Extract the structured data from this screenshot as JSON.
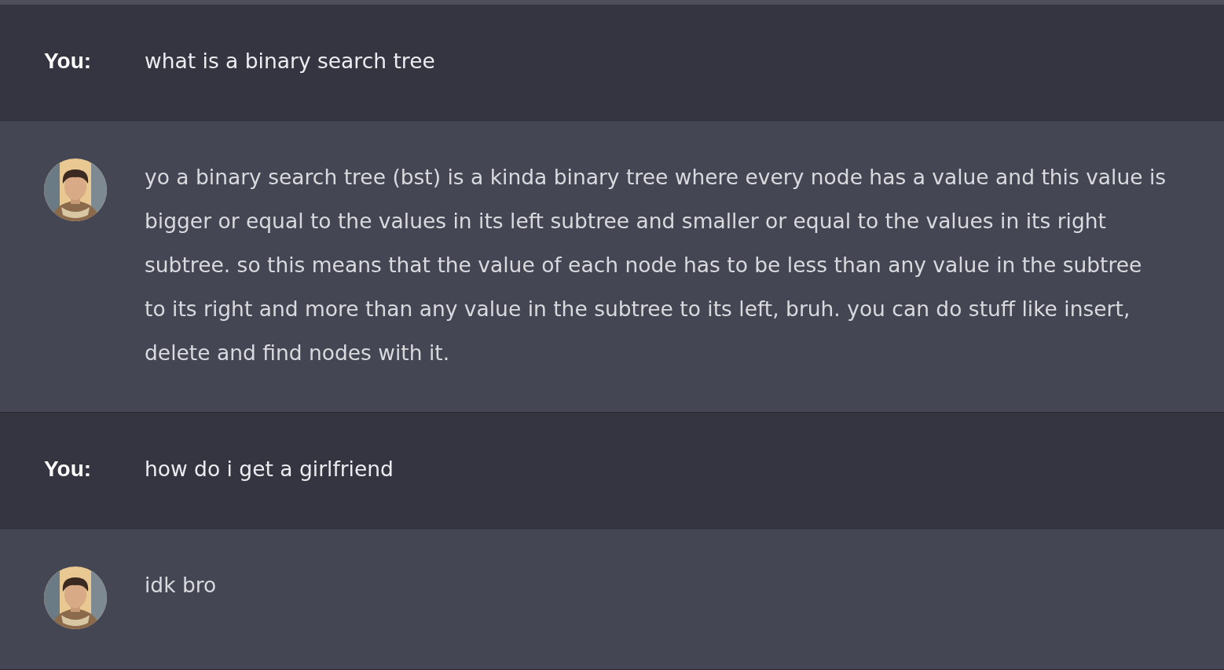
{
  "messages": [
    {
      "kind": "user",
      "label": "You:",
      "text": "what is a binary search tree"
    },
    {
      "kind": "assistant",
      "text": "yo a binary search tree (bst) is a kinda binary tree where every node has a value and this value is bigger or equal to the values in its left subtree and smaller or equal to the values in its right subtree. so this means that the value of each node has to be less than any value in the subtree to its right and more than any value in the subtree to its left, bruh. you can do stuff like insert, delete and find nodes with it."
    },
    {
      "kind": "user",
      "label": "You:",
      "text": "how do i get a girlfriend"
    },
    {
      "kind": "assistant",
      "text": "idk bro"
    }
  ]
}
